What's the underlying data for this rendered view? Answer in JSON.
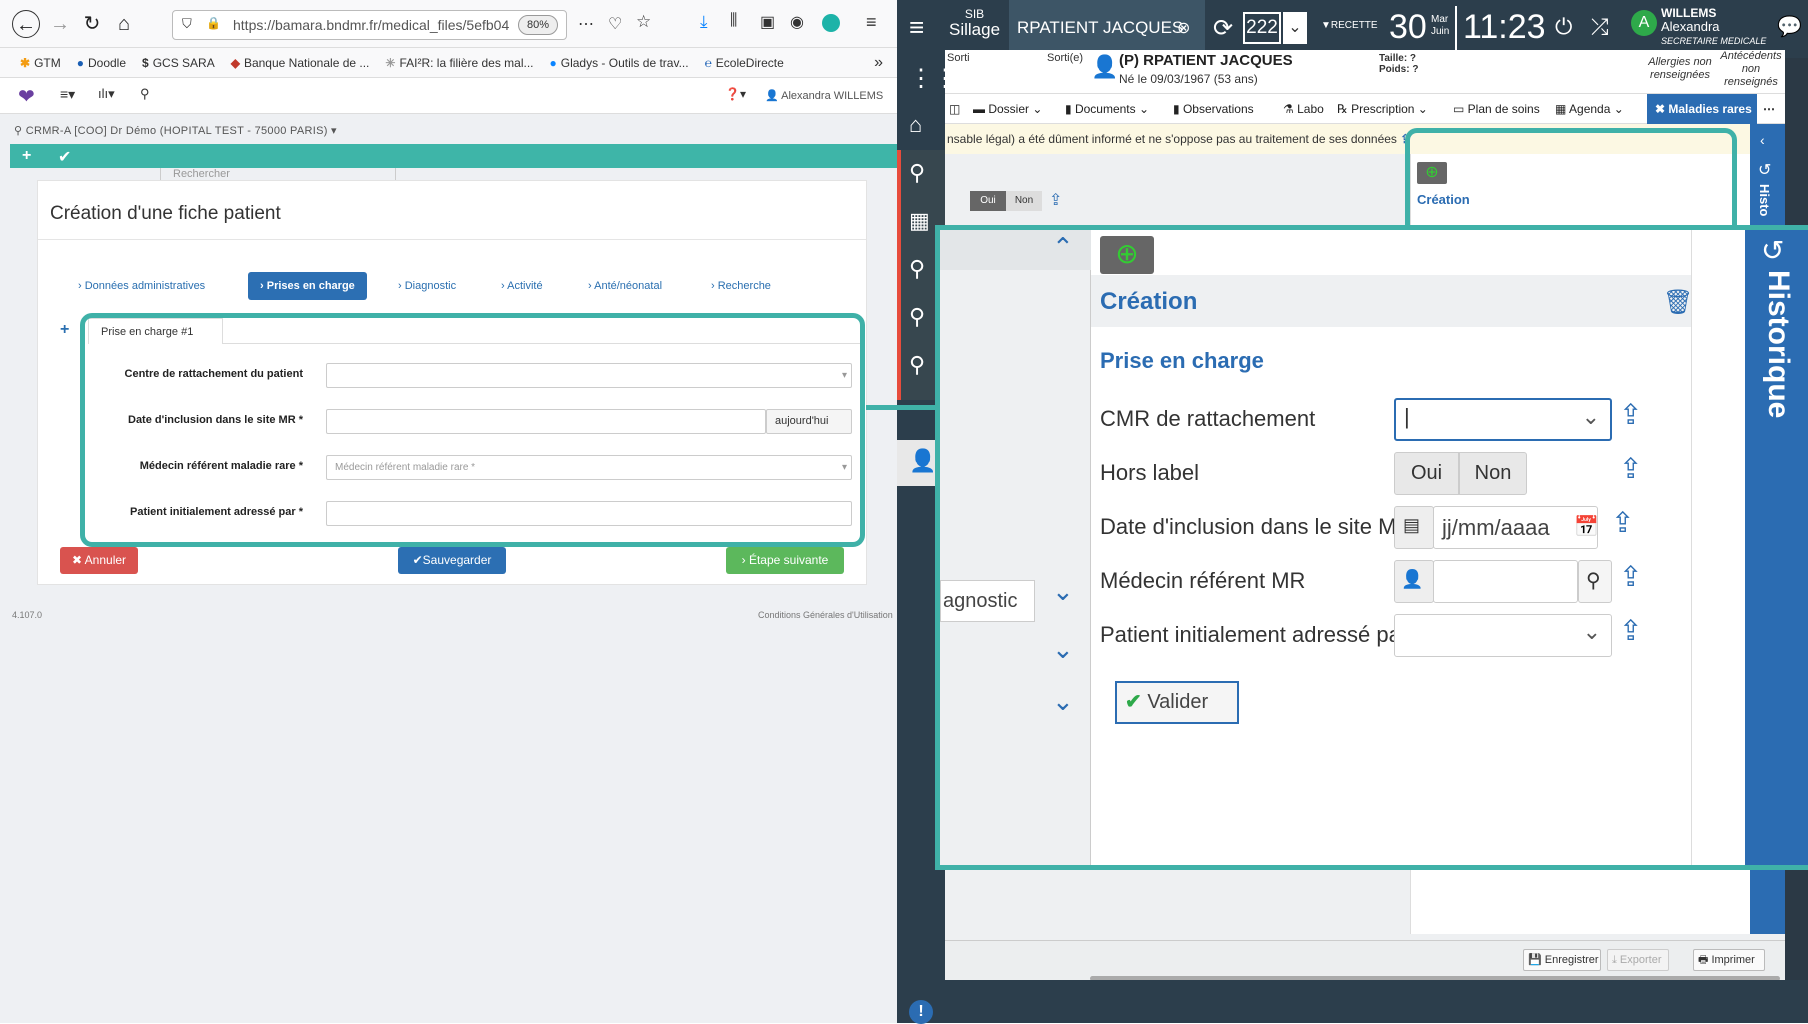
{
  "browser": {
    "url": "https://bamara.bndmr.fr/medical_files/5efb04",
    "zoom": "80%"
  },
  "bookmarks": [
    "GTM",
    "Doodle",
    "GCS SARA",
    "Banque Nationale de ...",
    "FAI²R: la filière des mal...",
    "Gladys - Outils de trav...",
    "EcoleDirecte"
  ],
  "left_app": {
    "search_placeholder": "Rechercher",
    "user": "Alexandra WILLEMS",
    "site": "CRMR-A [COO] Dr Démo (HOPITAL TEST - 75000 PARIS)",
    "title": "Création d'une fiche patient",
    "tabs": [
      "Données administratives",
      "Prises en charge",
      "Diagnostic",
      "Activité",
      "Anté/néonatal",
      "Recherche"
    ],
    "subtab": "Prise en charge #1",
    "fields": [
      {
        "label": "Centre de rattachement du patient",
        "value": ""
      },
      {
        "label": "Date d'inclusion dans le site MR *",
        "value": "",
        "addon": "aujourd'hui"
      },
      {
        "label": "Médecin référent maladie rare *",
        "placeholder": "Médecin référent maladie rare *"
      },
      {
        "label": "Patient initialement adressé par *",
        "value": ""
      }
    ],
    "cancel": "Annuler",
    "save": "Sauvegarder",
    "next": "Étape suivante",
    "version": "4.107.0",
    "cgu": "Conditions Générales d'Utilisation"
  },
  "right_app": {
    "brand_top": "SIB",
    "brand": "Sillage",
    "patient_name": "RPATIENT JACQUES",
    "count": "222",
    "recette": "RECETTE",
    "day": "30",
    "dow": "Mar",
    "month": "Juin",
    "time": "11:23",
    "user_last": "WILLEMS",
    "user_first": "Alexandra",
    "role": "SECRETAIRE MEDICALE",
    "avatar_letter": "A",
    "sorti": "Sorti",
    "sortie": "Sorti(e)",
    "patient_line": "(P) RPATIENT JACQUES",
    "birth": "Né le 09/03/1967 (53 ans)",
    "taille": "Taille: ?",
    "poids": "Poids: ?",
    "allergies": "Allergies non renseignées",
    "antecedents": "Antécédents non renseignés",
    "menu": [
      "Dossier",
      "Documents",
      "Observations",
      "Labo",
      "Prescription",
      "Plan de soins",
      "Agenda",
      "Maladies rares"
    ],
    "notice": "nsable légal) a été dûment informé et ne s'oppose pas au traitement de ses données",
    "oui": "Oui",
    "non": "Non",
    "mini_creation": "Création",
    "history": "Histo",
    "save": "Enregistrer",
    "export": "Exporter",
    "print": "Imprimer"
  },
  "zoom_panel": {
    "diag_tab": "agnostic",
    "creation": "Création",
    "section": "Prise en charge",
    "fields": [
      "CMR de rattachement",
      "Hors label",
      "Date d'inclusion dans le site MR",
      "Médecin référent MR",
      "Patient initialement adressé par"
    ],
    "oui": "Oui",
    "non": "Non",
    "date_placeholder": "jj/mm/aaaa",
    "validate": "Valider",
    "history": "Historique"
  }
}
